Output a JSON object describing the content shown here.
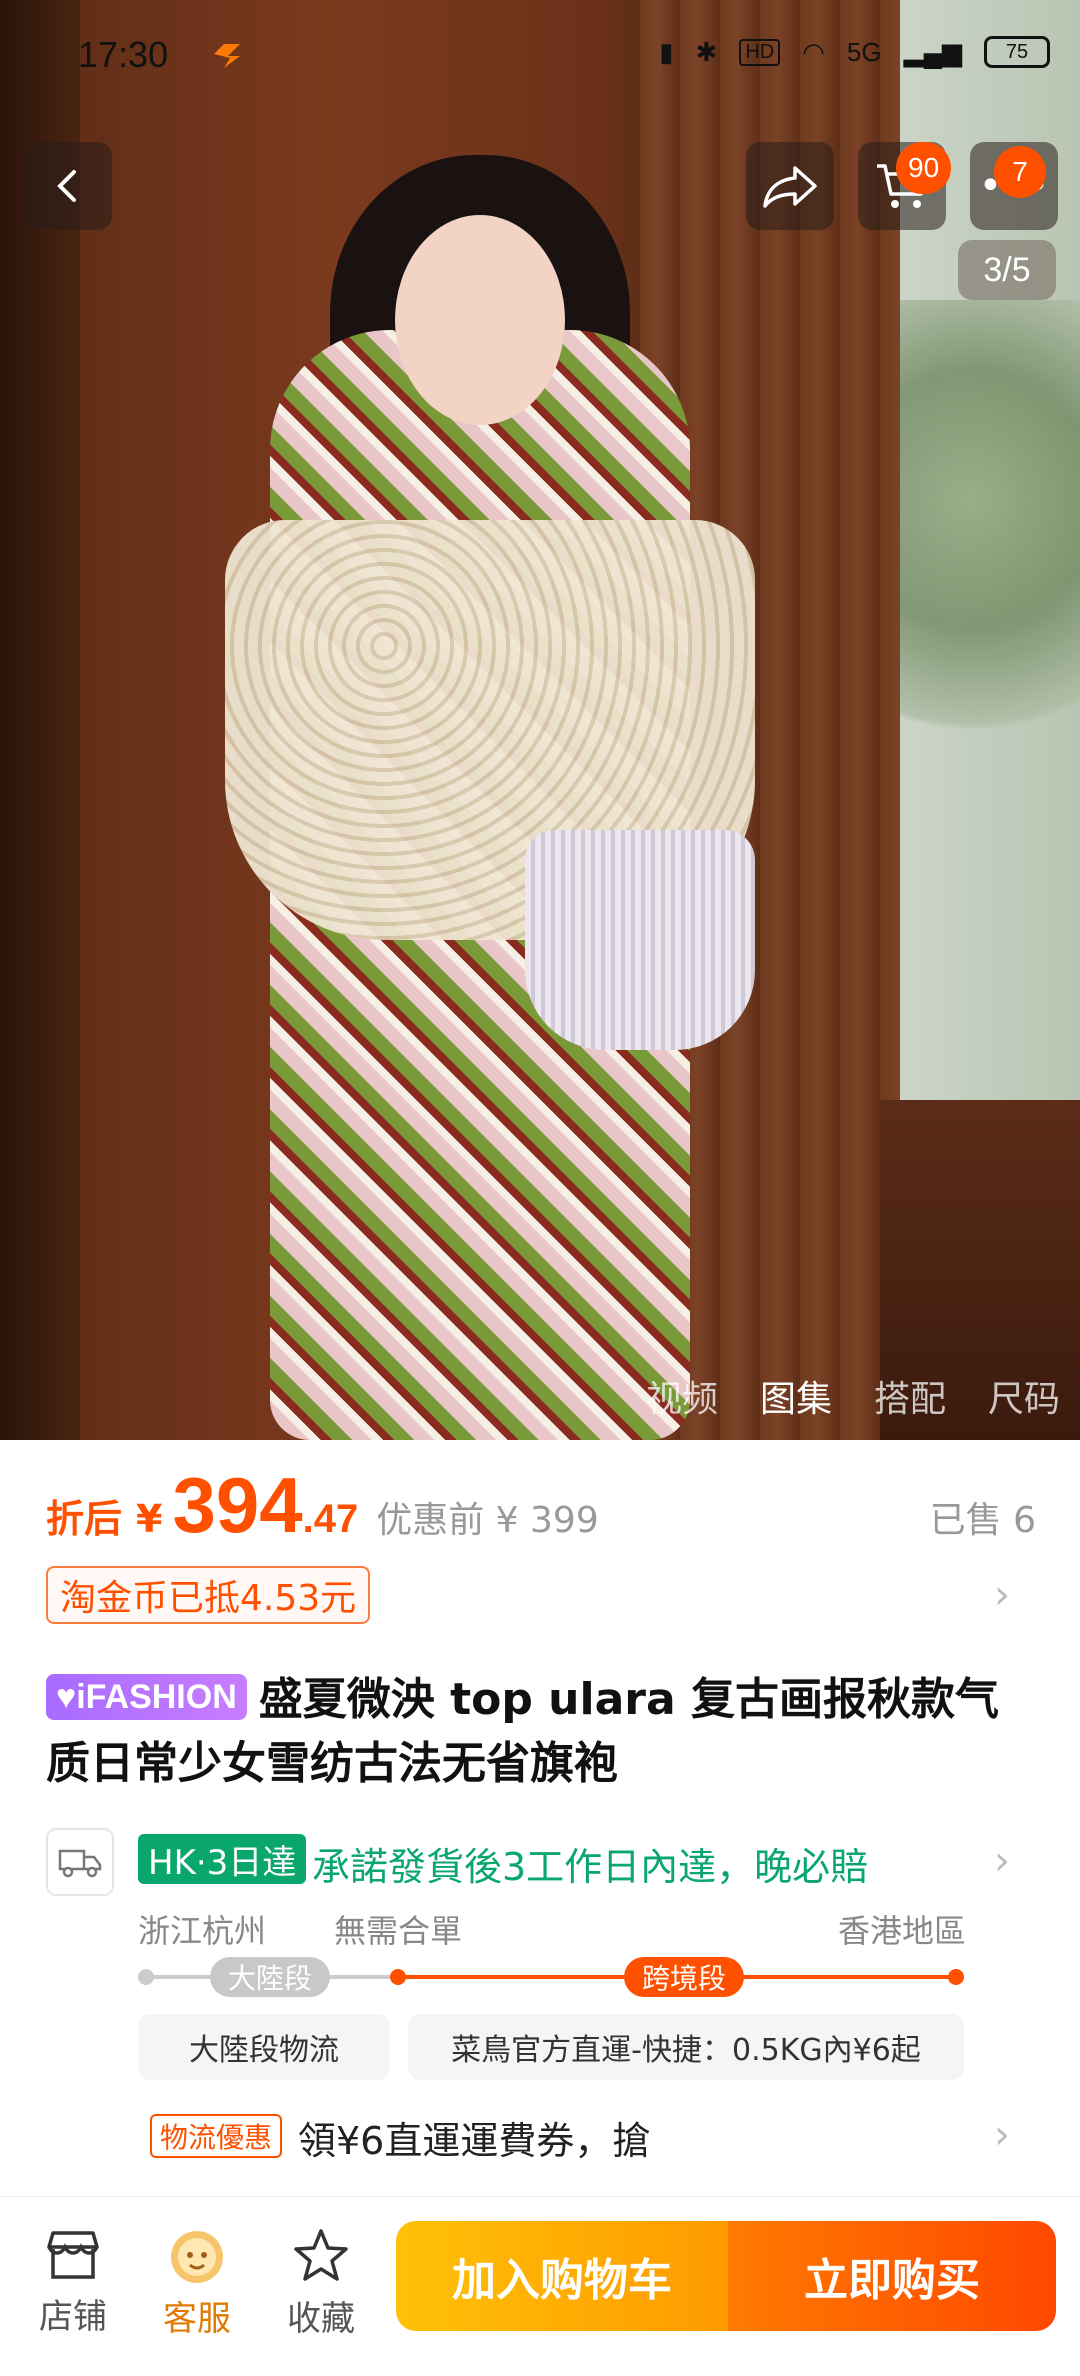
{
  "status_bar": {
    "time": "17:30",
    "network": "5G",
    "battery": "75"
  },
  "header": {
    "cart_count": "90",
    "more_count": "7",
    "page_indicator": "3/5"
  },
  "gallery_tabs": [
    "视频",
    "图集",
    "搭配",
    "尺码"
  ],
  "price": {
    "label": "折后",
    "currency": "¥",
    "integer": "394",
    "decimal": ".47",
    "original": "优惠前 ¥ 399",
    "sold": "已售 6",
    "coin_tag": "淘金币已抵4.53元"
  },
  "title": {
    "brand": "iFASHION",
    "text": "盛夏微泱 top ulara 复古画报秋款气质日常少女雪纺古法无省旗袍"
  },
  "shipping": {
    "badge": "HK·3日達",
    "promise": "承諾發貨後3工作日內達，晚必賠",
    "from": "浙江杭州",
    "merge": "無需合單",
    "to": "香港地區",
    "segment_mainland": "大陸段",
    "segment_cross": "跨境段",
    "chip_mainland": "大陸段物流",
    "chip_cross": "菜鳥官方直運-快捷：0.5KG內¥6起",
    "promo_tag": "物流優惠",
    "promo_text": "領¥6直運運費券，搶"
  },
  "bottom_bar": {
    "shop": "店铺",
    "service": "客服",
    "favorite": "收藏",
    "add_to_cart": "加入购物车",
    "buy_now": "立即购买"
  },
  "colors": {
    "accent": "#ff5000",
    "shipping_green": "#09a66d",
    "brand_purple": "#a86bff"
  }
}
